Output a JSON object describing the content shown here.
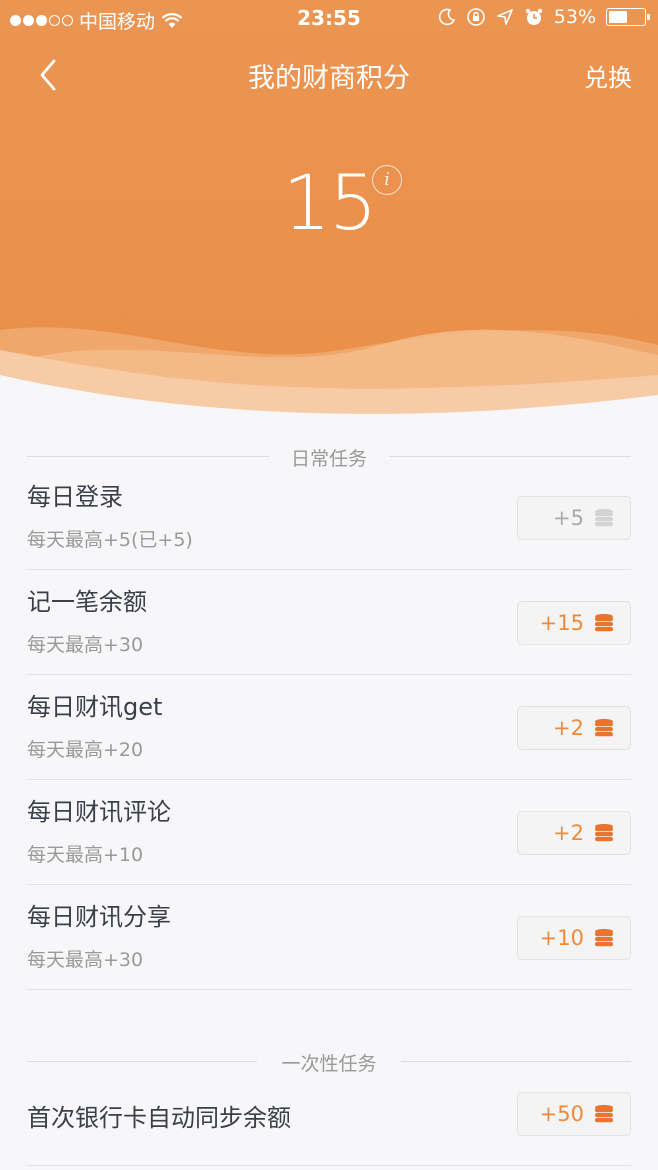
{
  "status_bar": {
    "carrier": "中国移动",
    "time": "23:55",
    "battery": "53%",
    "battery_level": 0.53
  },
  "nav": {
    "title": "我的财商积分",
    "action": "兑换"
  },
  "points": {
    "value": "15",
    "info": "i"
  },
  "sections": {
    "daily": "日常任务",
    "once": "一次性任务"
  },
  "tasks": [
    {
      "title": "每日登录",
      "subtitle": "每天最高+5(已+5)",
      "reward": "+5",
      "done": true
    },
    {
      "title": "记一笔余额",
      "subtitle": "每天最高+30",
      "reward": "+15",
      "done": false
    },
    {
      "title": "每日财讯get",
      "subtitle": "每天最高+20",
      "reward": "+2",
      "done": false
    },
    {
      "title": "每日财讯评论",
      "subtitle": "每天最高+10",
      "reward": "+2",
      "done": false
    },
    {
      "title": "每日财讯分享",
      "subtitle": "每天最高+30",
      "reward": "+10",
      "done": false
    },
    {
      "title": "首次银行卡自动同步余额",
      "subtitle": "",
      "reward": "+50",
      "done": false
    }
  ],
  "colors": {
    "header": "#ea8f47",
    "accent": "#ee8a3a",
    "coin": "#e8752f",
    "coin_done": "#d3d3d3"
  }
}
